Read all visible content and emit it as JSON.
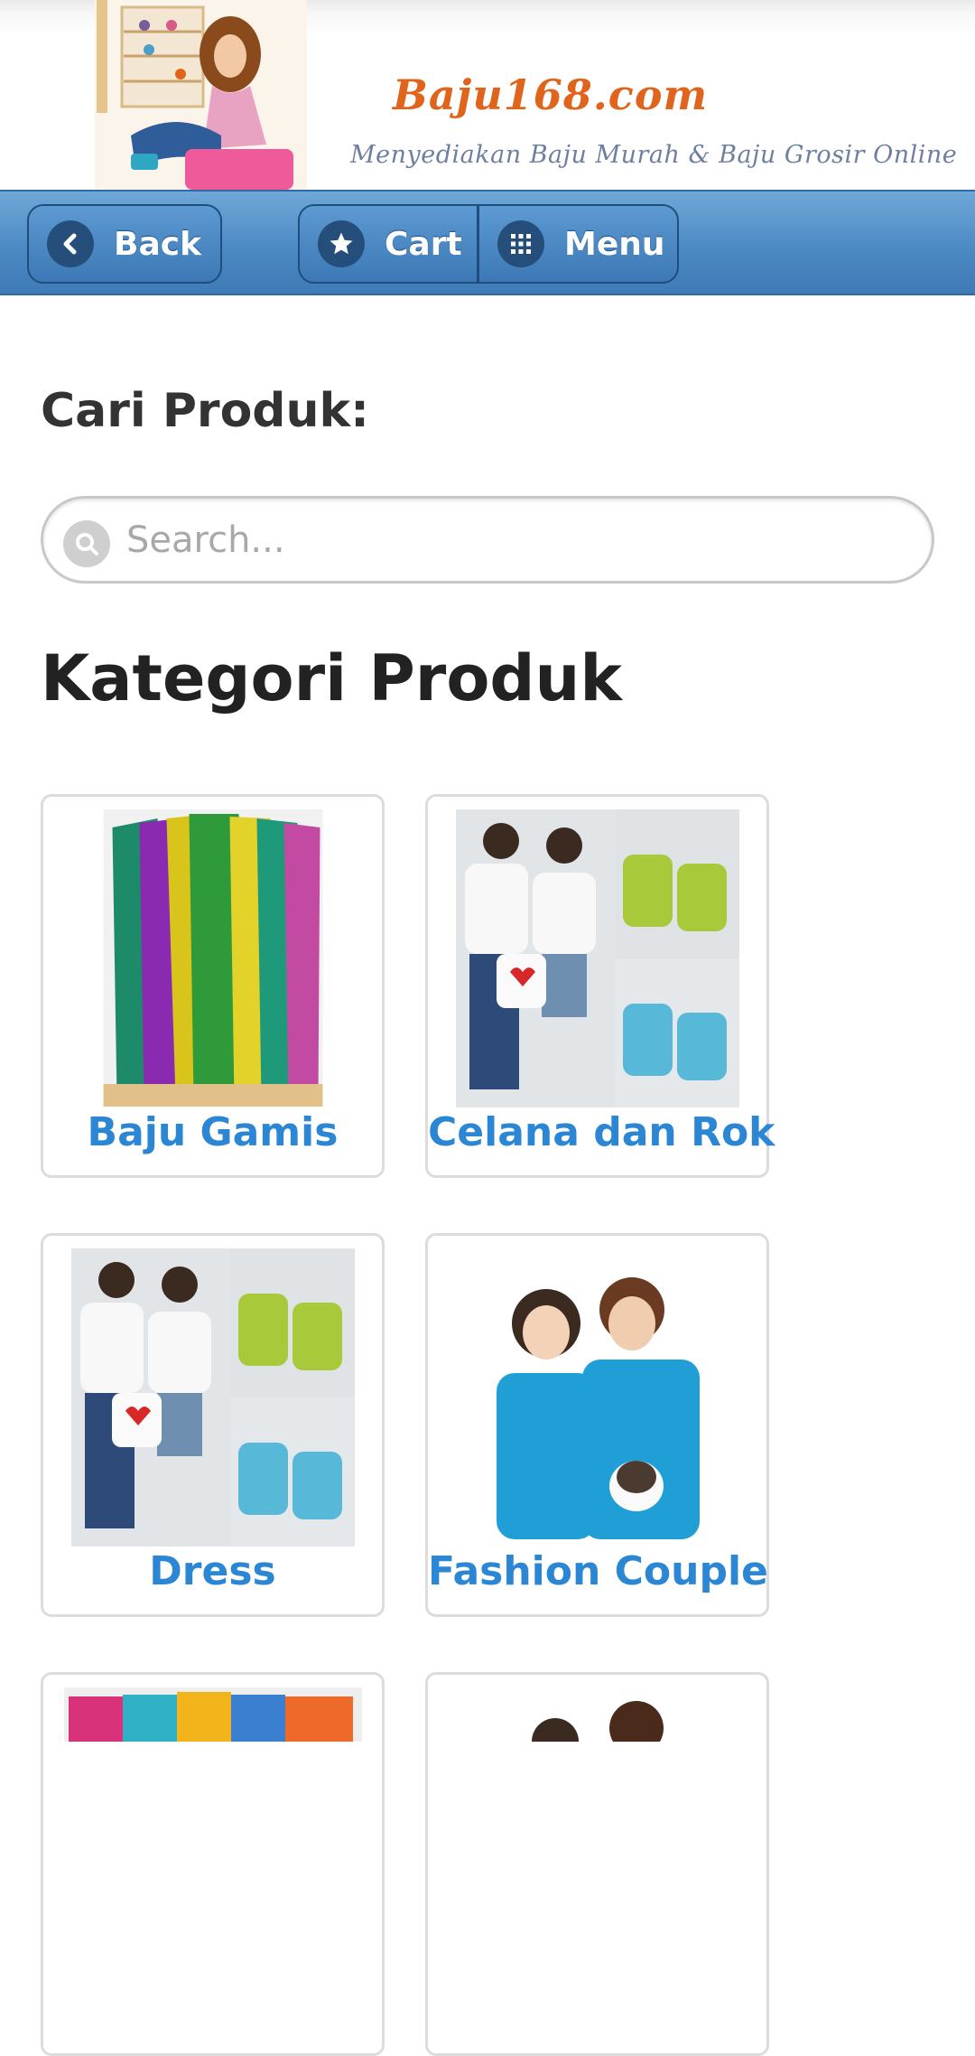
{
  "banner": {
    "site_name": "Baju168.com",
    "tagline": "Menyediakan Baju Murah & Baju Grosir Online"
  },
  "toolbar": {
    "back_label": "Back",
    "cart_label": "Cart",
    "menu_label": "Menu",
    "icons": [
      "chevron-left-icon",
      "star-icon",
      "grid-icon"
    ]
  },
  "search": {
    "label": "Cari Produk:",
    "placeholder": "Search..."
  },
  "categories": {
    "heading": "Kategori Produk",
    "items": [
      {
        "label": "Baju Gamis"
      },
      {
        "label": "Celana dan Rok"
      },
      {
        "label": "Dress"
      },
      {
        "label": "Fashion Couple"
      },
      {
        "label": ""
      },
      {
        "label": ""
      }
    ]
  },
  "colors": {
    "toolbar": "#4a88c2",
    "link": "#2b86d4",
    "brand_orange": "#e0641c"
  }
}
